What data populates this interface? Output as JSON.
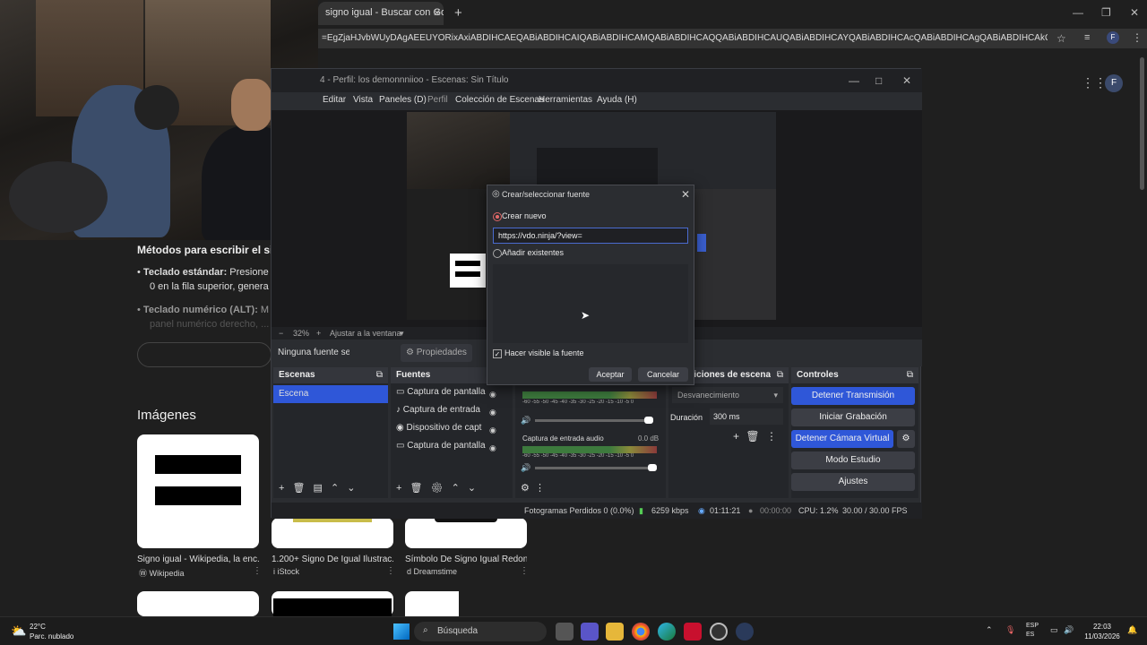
{
  "browser": {
    "tab_title": "signo igual - Buscar con Google",
    "tab_close": "✕",
    "new_tab": "+",
    "address": "=EgZjaHJvbWUyDAgAEEUYORixAxiABDIHCAEQABiABDIHCAIQABiABDIHCAMQABiABDIHCAQQABiABDIHCAUQABiABDIHCAYQABiABDIHCAcQABiABDIHCAgQABiABDIHCAkQABiABNIBCDIwMzIqM...",
    "profile_letter": "F"
  },
  "google_page": {
    "heading": "Métodos para escribir el signo",
    "item1_bold": "Teclado estándar:",
    "item1_text": " Presione",
    "item1_line2": "0  en la fila superior, genera",
    "item2_bold": "Teclado numérico (ALT):",
    "item2_text": " M",
    "item2_line2": "panel numérico derecho, ...",
    "images_heading": "Imágenes",
    "cards": [
      {
        "title": "Signo igual - Wikipedia, la enc...",
        "source": "Wikipedia"
      },
      {
        "title": "1.200+ Signo De Igual Ilustrac...",
        "source": "iStock"
      },
      {
        "title": "Símbolo De Signo Igual Redon...",
        "source": "Dreamstime"
      }
    ]
  },
  "obs": {
    "title": "4 - Perfil: los demonnniioo - Escenas: Sin Título",
    "menu": [
      "Editar",
      "Vista",
      "Paneles (D)",
      "Perfil",
      "Colección de Escenas",
      "Herramientas",
      "Ayuda (H)"
    ],
    "zoom": "32%",
    "fit": "Ajustar a la ventana",
    "no_source": "Ninguna fuente seleccionad",
    "properties": "Propiedades",
    "scenes_header": "Escenas",
    "scenes": [
      "Escena"
    ],
    "sources_header": "Fuentes",
    "sources": [
      "Captura de pantalla",
      "Captura de entrada",
      "Dispositivo de capt",
      "Captura de pantalla"
    ],
    "mixer_track2": "Captura de entrada audio",
    "mixer_db": "0.0 dB",
    "meter_scale": "-60 -55 -50 -45 -40 -35 -30 -25 -20 -15 -10 -5 0",
    "transitions_header": "Transiciones de escena",
    "transition_value": "Desvanecimiento",
    "duration_label": "Duración",
    "duration_value": "300 ms",
    "controls_header": "Controles",
    "controls": {
      "stop_stream": "Detener Transmisión",
      "start_record": "Iniciar Grabación",
      "stop_vcam": "Detener Cámara Virtual",
      "studio": "Modo Estudio",
      "settings": "Ajustes"
    },
    "status": {
      "dropped": "Fotogramas Perdidos 0 (0.0%)",
      "kbps": "6259 kbps",
      "live_time": "01:11:21",
      "rec_time": "00:00:00",
      "cpu": "CPU: 1.2%",
      "fps": "30.00 / 30.00 FPS"
    }
  },
  "dialog": {
    "title": "Crear/seleccionar fuente",
    "create_new": "Crear nuevo",
    "name_value": "https://vdo.ninja/?view=",
    "add_existing": "Añadir existentes",
    "visible_label": "Hacer visible la fuente",
    "ok": "Aceptar",
    "cancel": "Cancelar"
  },
  "taskbar": {
    "temp": "22°C",
    "weather": "Parc. nublado",
    "search": "Búsqueda",
    "lang1": "ESP",
    "lang2": "ES",
    "time": "22:03",
    "date": "11/03/2026"
  }
}
